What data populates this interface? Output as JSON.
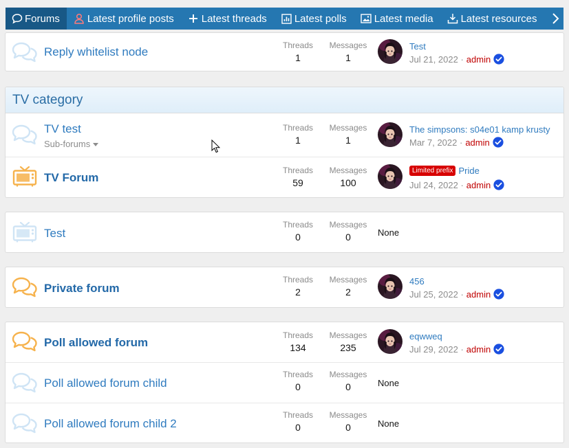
{
  "nav": {
    "tabs": [
      {
        "label": "Forums"
      },
      {
        "label": "Latest profile posts"
      },
      {
        "label": "Latest threads"
      },
      {
        "label": "Latest polls"
      },
      {
        "label": "Latest media"
      },
      {
        "label": "Latest resources"
      }
    ]
  },
  "labels": {
    "threads": "Threads",
    "messages": "Messages",
    "none": "None",
    "subforums": "Sub-forums"
  },
  "block1": {
    "node": {
      "title": "Reply whitelist node",
      "threads": "1",
      "messages": "1",
      "last_title": "Test",
      "last_date": "Jul 21, 2022",
      "last_user": "admin"
    }
  },
  "block2": {
    "category": "TV category",
    "nodes": [
      {
        "title": "TV test",
        "threads": "1",
        "messages": "1",
        "last_title": "The simpsons: s04e01 kamp krusty",
        "last_date": "Mar 7, 2022",
        "last_user": "admin"
      },
      {
        "title": "TV Forum",
        "threads": "59",
        "messages": "100",
        "prefix": "Limited prefix",
        "last_title": "Pride",
        "last_date": "Jul 24, 2022",
        "last_user": "admin"
      }
    ]
  },
  "block3": {
    "node": {
      "title": "Test",
      "threads": "0",
      "messages": "0"
    }
  },
  "block4": {
    "node": {
      "title": "Private forum",
      "threads": "2",
      "messages": "2",
      "last_title": "456",
      "last_date": "Jul 25, 2022",
      "last_user": "admin"
    }
  },
  "block5": {
    "nodes": [
      {
        "title": "Poll allowed forum",
        "threads": "134",
        "messages": "235",
        "last_title": "eqwweq",
        "last_date": "Jul 29, 2022",
        "last_user": "admin"
      },
      {
        "title": "Poll allowed forum child",
        "threads": "0",
        "messages": "0"
      },
      {
        "title": "Poll allowed forum child 2",
        "threads": "0",
        "messages": "0"
      }
    ]
  },
  "colors": {
    "nav": "#2577b1",
    "nav_active": "#185886",
    "link": "#2f7bbf",
    "user": "#c00000",
    "prefix": "#d70000",
    "unread_icon": "#f6b24c",
    "read_icon": "#cfe4f5"
  },
  "icons": [
    "chat-bubbles-icon",
    "tv-icon",
    "verified-icon",
    "chevron-right-icon",
    "mouse-cursor-icon"
  ]
}
